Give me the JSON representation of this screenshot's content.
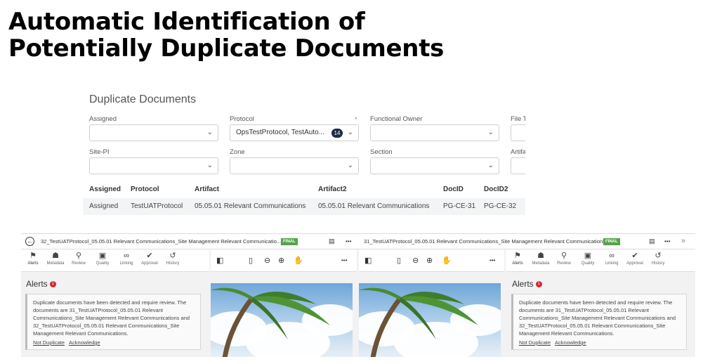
{
  "slide": {
    "title": "Automatic Identification of Potentially Duplicate Documents"
  },
  "duplicates": {
    "title": "Duplicate Documents",
    "filters": {
      "assigned": {
        "label": "Assigned",
        "value": ""
      },
      "protocol": {
        "label": "Protocol",
        "value": "OpsTestProtocol, TestAuto...",
        "count": "14",
        "required_mark": "*"
      },
      "functional_owner": {
        "label": "Functional Owner",
        "value": ""
      },
      "file_type": {
        "label": "File T",
        "value": ""
      },
      "site_pi": {
        "label": "Site-PI",
        "value": ""
      },
      "zone": {
        "label": "Zone",
        "value": ""
      },
      "section": {
        "label": "Section",
        "value": ""
      },
      "artifact": {
        "label": "Artifa",
        "value": ""
      }
    },
    "table": {
      "headers": [
        "Assigned",
        "Protocol",
        "Artifact",
        "Artifact2",
        "DocID",
        "DocID2"
      ],
      "rows": [
        [
          "Assigned",
          "TestUATProtocol",
          "05.05.01 Relevant Communications",
          "05.05.01 Relevant Communications",
          "PG-CE-31",
          "PG-CE-32"
        ]
      ]
    }
  },
  "viewer": {
    "left_doc": {
      "title": "32_TestUATProtocol_05.05.01 Relevant Communications_Site Management Relevant Communicatio...",
      "status": "FINAL"
    },
    "right_doc": {
      "title": "31_TestUATProtocol_05.05.01 Relevant Communications_Site Management Relevant Communications",
      "status": "FINAL"
    },
    "tabs": [
      "Alerts",
      "Metadata",
      "Review",
      "Quality",
      "Linking",
      "Approval",
      "History"
    ],
    "alerts": {
      "title": "Alerts",
      "count": "1",
      "message": "Duplicate documents have been detected and require review. The documents are 31_TestUATProtocol_05.05.01 Relevant Communications_Site Management Relevant Communications and 32_TestUATProtocol_05.05.01 Relevant Communications_Site Management Relevant Communications.",
      "not_duplicate": "Not Duplicate",
      "acknowledge": "Acknowledge"
    },
    "more": "•••",
    "expand": "»"
  }
}
